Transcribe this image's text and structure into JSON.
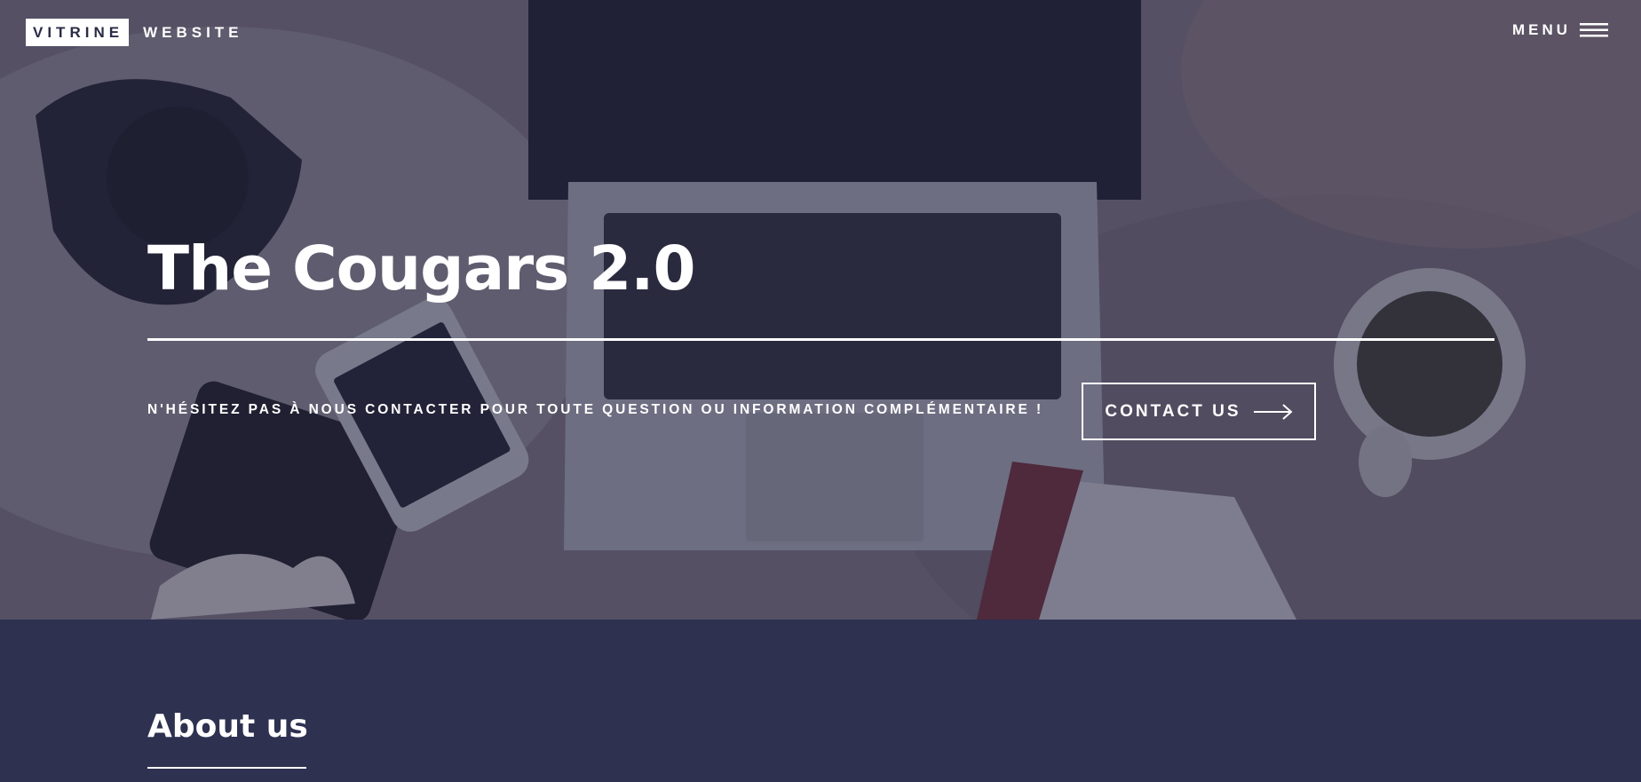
{
  "header": {
    "brand_box": "VITRINE",
    "brand_word": "WEBSITE",
    "menu_label": "MENU",
    "menu_icon": "hamburger-icon"
  },
  "hero": {
    "title": "The Cougars 2.0",
    "tagline": "N'HÉSITEZ PAS À NOUS CONTACTER POUR TOUTE QUESTION OU INFORMATION COMPLÉMENTAIRE !",
    "contact_label": "CONTACT US",
    "contact_icon": "arrow-right-icon"
  },
  "about": {
    "title": "About us"
  },
  "colors": {
    "accent": "#ffffff",
    "section_bg": "#2e3150",
    "overlay": "#2a2a48"
  }
}
